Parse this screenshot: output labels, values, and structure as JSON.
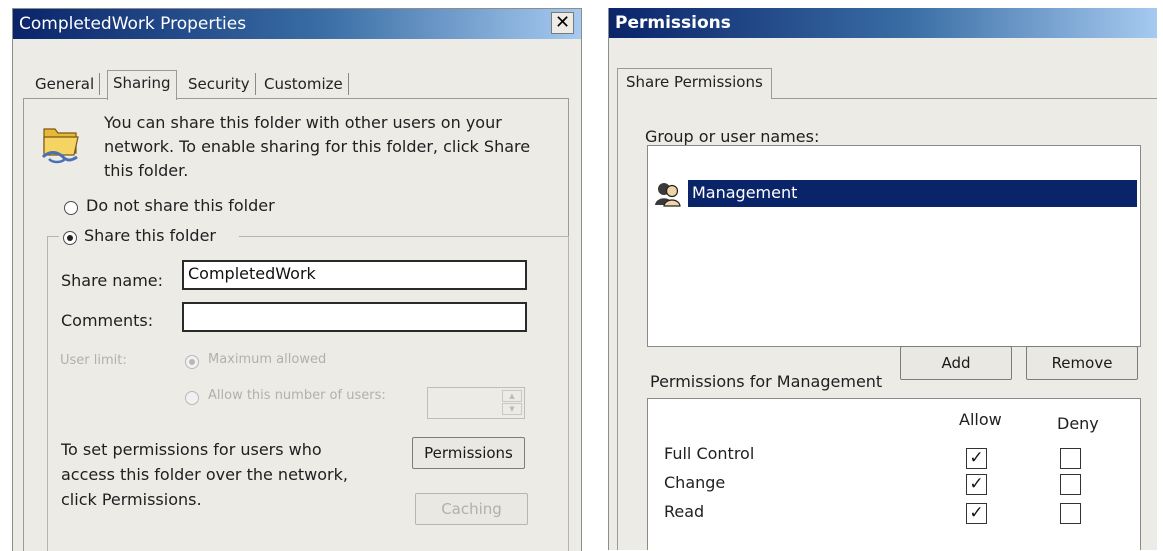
{
  "properties_dialog": {
    "title": "CompletedWork Properties",
    "close_glyph": "✕",
    "tabs": [
      {
        "label": "General",
        "selected": false
      },
      {
        "label": "Sharing",
        "selected": true
      },
      {
        "label": "Security",
        "selected": false
      },
      {
        "label": "Customize",
        "selected": false
      }
    ],
    "info_text_lines": [
      "You can share this folder with other users on your",
      "network.  To enable sharing for this folder, click Share",
      "this folder."
    ],
    "radio_do_not_share": {
      "label": "Do not share this folder",
      "checked": false
    },
    "radio_share": {
      "label": "Share this folder",
      "checked": true
    },
    "share_name": {
      "label": "Share name:",
      "value": "CompletedWork"
    },
    "comments": {
      "label": "Comments:",
      "value": ""
    },
    "user_limit": {
      "label": "User limit:",
      "maximum_allowed": {
        "label": "Maximum allowed",
        "checked": true
      },
      "allow_number": {
        "label": "Allow this number of users:",
        "checked": false,
        "value": ""
      }
    },
    "permissions_text_lines": [
      "To set permissions for users who",
      "access this folder over the network,",
      "click Permissions."
    ],
    "permissions_button": "Permissions",
    "caching_button": "Caching"
  },
  "permissions_dialog": {
    "title": "Permissions",
    "tab": "Share Permissions",
    "group_label": "Group or user names:",
    "users": [
      {
        "name": "Management",
        "selected": true,
        "icon": "user-group-icon"
      }
    ],
    "add_button": "Add",
    "remove_button": "Remove",
    "permissions_for_label": "Permissions for Management",
    "columns": [
      "Allow",
      "Deny"
    ],
    "permissions": [
      {
        "name": "Full Control",
        "allow": true,
        "deny": false
      },
      {
        "name": "Change",
        "allow": true,
        "deny": false
      },
      {
        "name": "Read",
        "allow": true,
        "deny": false
      }
    ]
  },
  "colors": {
    "title_gradient_start": "#0a246a",
    "title_gradient_end": "#a6caf0",
    "selection": "#0a246a",
    "dialog_bg": "#ecebe6"
  }
}
